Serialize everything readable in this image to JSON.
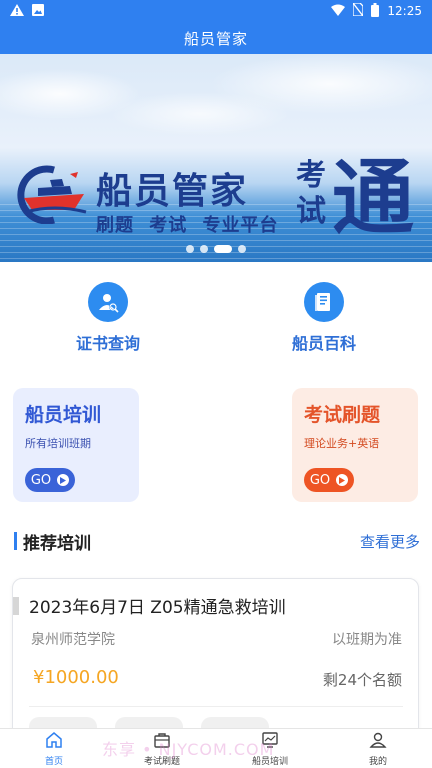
{
  "status_bar": {
    "time": "12:25"
  },
  "app": {
    "title": "船员管家"
  },
  "banner": {
    "title": "船员管家",
    "subtitle": "刷题 考试 专业平台",
    "kaoshi": "考试",
    "tong": "通",
    "slides": 4,
    "active_slide": 2
  },
  "quick_links": [
    {
      "label": "证书查询",
      "icon": "certificate-search-icon"
    },
    {
      "label": "船员百科",
      "icon": "encyclopedia-book-icon"
    }
  ],
  "cards": {
    "training": {
      "title": "船员培训",
      "subtitle": "所有培训班期",
      "button": "GO"
    },
    "exam": {
      "title": "考试刷题",
      "subtitle": "理论业务+英语",
      "button": "GO"
    }
  },
  "recommend": {
    "title": "推荐培训",
    "more": "查看更多",
    "item": {
      "title": "2023年6月7日 Z05精通急救培训",
      "org": "泉州师范学院",
      "period": "以班期为准",
      "price": "¥1000.00",
      "quota": "剩24个名额"
    }
  },
  "tabbar": {
    "tabs": [
      {
        "label": "首页",
        "icon": "home-icon",
        "active": true
      },
      {
        "label": "考试刷题",
        "icon": "briefcase-icon",
        "active": false
      },
      {
        "label": "船员培训",
        "icon": "chart-screen-icon",
        "active": false
      },
      {
        "label": "我的",
        "icon": "user-icon",
        "active": false
      }
    ]
  },
  "watermark": "东享 • NJYCOM.COM",
  "colors": {
    "primary": "#2f80f0",
    "orange": "#ee5424",
    "price": "#f5a623",
    "navy": "#1d3d8f"
  }
}
